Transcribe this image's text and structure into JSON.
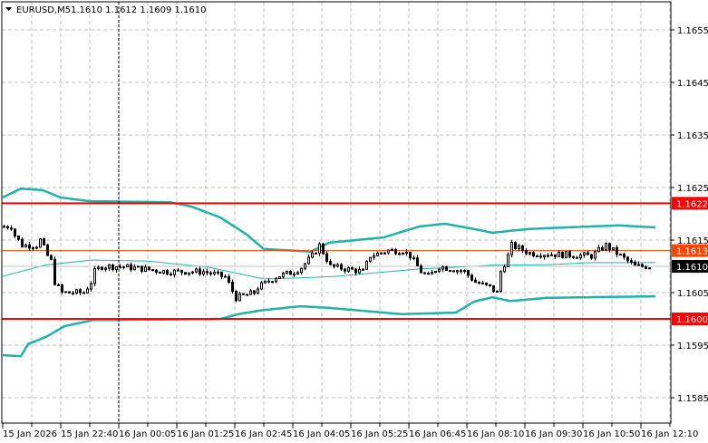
{
  "header": {
    "symbol_timeframe": "EURUSD,M5",
    "ohlc": "1.1610 1.1612 1.1609 1.1610"
  },
  "colors": {
    "background": "#ffffff",
    "grid": "#c0c0c0",
    "bollinger": "#20b2aa",
    "level_line": "#ff0000",
    "ask_line": "#ff4500",
    "bid_line": "#c0c0c0",
    "bid_label": "#000000"
  },
  "price_axis": {
    "labels": [
      "1.1655",
      "1.1645",
      "1.1635",
      "1.1625",
      "1.1615",
      "1.1605",
      "1.1595",
      "1.1585"
    ],
    "range": [
      1.158,
      1.1661
    ]
  },
  "time_axis": {
    "labels": [
      "15 Jan 2026",
      "15 Jan 22:40",
      "16 Jan 00:05",
      "16 Jan 01:25",
      "16 Jan 02:45",
      "16 Jan 04:05",
      "16 Jan 05:25",
      "16 Jan 06:45",
      "16 Jan 08:10",
      "16 Jan 09:30",
      "16 Jan 10:50",
      "16 Jan 12:10"
    ],
    "bars_per_label": 16
  },
  "levels": [
    {
      "price": 1.1622,
      "label": "1.1622",
      "type": "resistance"
    },
    {
      "price": 1.16,
      "label": "1.1600",
      "type": "support"
    }
  ],
  "ask": {
    "price": 1.1613,
    "label": "1.1613"
  },
  "bid": {
    "price": 1.161,
    "label": "1.1610"
  },
  "crosshair_bar": 32,
  "chart_data": {
    "type": "candlestick",
    "bar_count": 179,
    "close_path": [
      [
        0,
        1.16176
      ],
      [
        2,
        1.16176
      ],
      [
        3,
        1.16159
      ],
      [
        5,
        1.1614
      ],
      [
        9,
        1.1614
      ],
      [
        10,
        1.1615
      ],
      [
        12,
        1.1612
      ],
      [
        13,
        1.1611
      ],
      [
        14,
        1.1607
      ],
      [
        16,
        1.1605
      ],
      [
        22,
        1.1605
      ],
      [
        24,
        1.1607
      ],
      [
        25,
        1.1609
      ],
      [
        27,
        1.161
      ],
      [
        32,
        1.161
      ],
      [
        45,
        1.1609
      ],
      [
        55,
        1.1609
      ],
      [
        61,
        1.1608
      ],
      [
        64,
        1.1604
      ],
      [
        69,
        1.1605
      ],
      [
        70,
        1.1606
      ],
      [
        75,
        1.1608
      ],
      [
        80,
        1.1609
      ],
      [
        82,
        1.16098
      ],
      [
        85,
        1.1612
      ],
      [
        87,
        1.1614
      ],
      [
        90,
        1.161
      ],
      [
        99,
        1.1609
      ],
      [
        101,
        1.1612
      ],
      [
        106,
        1.1613
      ],
      [
        110,
        1.1613
      ],
      [
        112,
        1.1612
      ],
      [
        115,
        1.1609
      ],
      [
        117,
        1.1608
      ],
      [
        120,
        1.161
      ],
      [
        127,
        1.1609
      ],
      [
        130,
        1.1607
      ],
      [
        134,
        1.1606
      ],
      [
        136,
        1.1605
      ],
      [
        137,
        1.1609
      ],
      [
        139,
        1.1612
      ],
      [
        140,
        1.1614
      ],
      [
        145,
        1.16125
      ],
      [
        162,
        1.1612
      ],
      [
        166,
        1.1614
      ],
      [
        170,
        1.1612
      ],
      [
        174,
        1.161
      ],
      [
        178,
        1.161
      ]
    ],
    "bollinger_upper": [
      [
        0,
        1.16231
      ],
      [
        5,
        1.16248
      ],
      [
        11,
        1.16245
      ],
      [
        16,
        1.16231
      ],
      [
        24,
        1.16224
      ],
      [
        46,
        1.16222
      ],
      [
        52,
        1.16214
      ],
      [
        60,
        1.16193
      ],
      [
        67,
        1.16162
      ],
      [
        72,
        1.16133
      ],
      [
        85,
        1.16128
      ],
      [
        90,
        1.16145
      ],
      [
        105,
        1.16155
      ],
      [
        115,
        1.16176
      ],
      [
        122,
        1.16181
      ],
      [
        130,
        1.16171
      ],
      [
        135,
        1.16164
      ],
      [
        145,
        1.16171
      ],
      [
        155,
        1.16174
      ],
      [
        170,
        1.16178
      ],
      [
        180,
        1.16174
      ]
    ],
    "bollinger_middle": [
      [
        0,
        1.16081
      ],
      [
        12,
        1.16103
      ],
      [
        25,
        1.16112
      ],
      [
        40,
        1.1611
      ],
      [
        57,
        1.16098
      ],
      [
        72,
        1.16076
      ],
      [
        82,
        1.16078
      ],
      [
        92,
        1.16081
      ],
      [
        100,
        1.16086
      ],
      [
        115,
        1.16095
      ],
      [
        135,
        1.16102
      ],
      [
        150,
        1.16103
      ],
      [
        162,
        1.16107
      ],
      [
        180,
        1.16107
      ]
    ],
    "bollinger_lower": [
      [
        0,
        1.15931
      ],
      [
        5,
        1.15929
      ],
      [
        7,
        1.15952
      ],
      [
        12,
        1.15966
      ],
      [
        17,
        1.15986
      ],
      [
        25,
        1.15998
      ],
      [
        32,
        1.15998
      ],
      [
        60,
        1.16
      ],
      [
        65,
        1.16009
      ],
      [
        71,
        1.16016
      ],
      [
        82,
        1.16024
      ],
      [
        90,
        1.16021
      ],
      [
        110,
        1.16009
      ],
      [
        125,
        1.16012
      ],
      [
        130,
        1.16033
      ],
      [
        135,
        1.16041
      ],
      [
        140,
        1.16034
      ],
      [
        150,
        1.1604
      ],
      [
        180,
        1.16043
      ]
    ]
  }
}
